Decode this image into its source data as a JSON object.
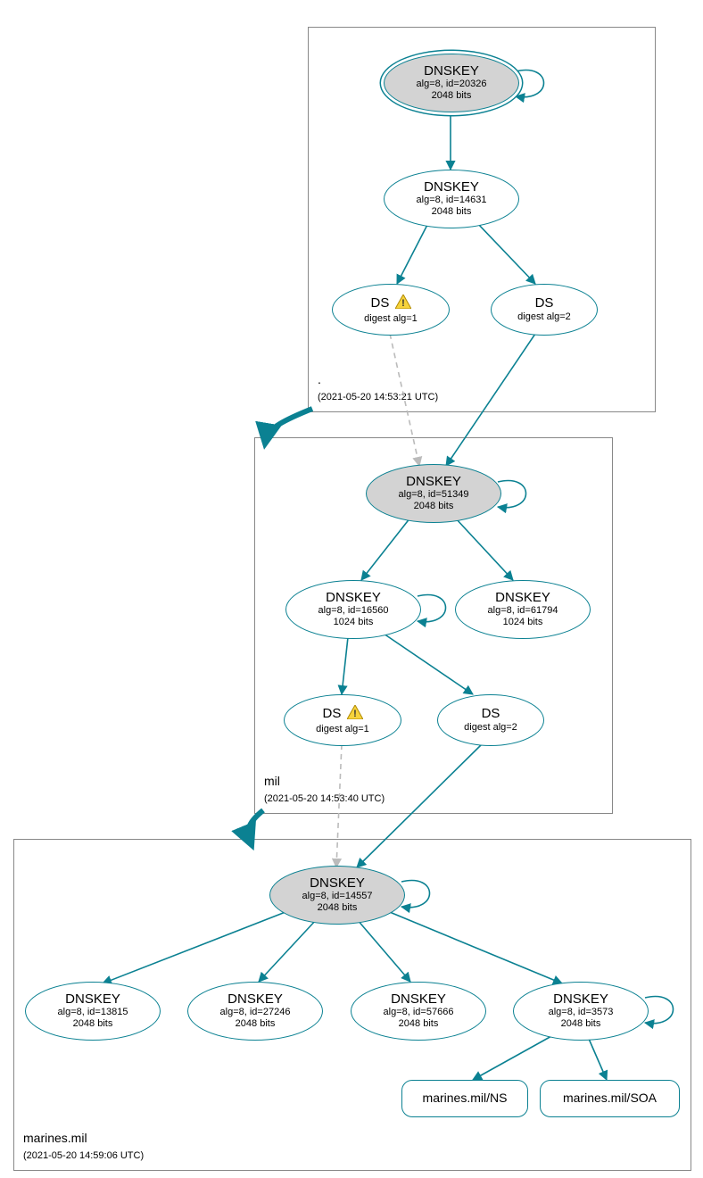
{
  "zones": {
    "root": {
      "name": ".",
      "timestamp": "(2021-05-20 14:53:21 UTC)"
    },
    "mil": {
      "name": "mil",
      "timestamp": "(2021-05-20 14:53:40 UTC)"
    },
    "marines": {
      "name": "marines.mil",
      "timestamp": "(2021-05-20 14:59:06 UTC)"
    }
  },
  "nodes": {
    "root_ksk": {
      "title": "DNSKEY",
      "line2": "alg=8, id=20326",
      "line3": "2048 bits"
    },
    "root_zsk": {
      "title": "DNSKEY",
      "line2": "alg=8, id=14631",
      "line3": "2048 bits"
    },
    "root_ds1": {
      "title": "DS",
      "line2": "digest alg=1"
    },
    "root_ds2": {
      "title": "DS",
      "line2": "digest alg=2"
    },
    "mil_ksk": {
      "title": "DNSKEY",
      "line2": "alg=8, id=51349",
      "line3": "2048 bits"
    },
    "mil_zsk1": {
      "title": "DNSKEY",
      "line2": "alg=8, id=16560",
      "line3": "1024 bits"
    },
    "mil_zsk2": {
      "title": "DNSKEY",
      "line2": "alg=8, id=61794",
      "line3": "1024 bits"
    },
    "mil_ds1": {
      "title": "DS",
      "line2": "digest alg=1"
    },
    "mil_ds2": {
      "title": "DS",
      "line2": "digest alg=2"
    },
    "mar_ksk": {
      "title": "DNSKEY",
      "line2": "alg=8, id=14557",
      "line3": "2048 bits"
    },
    "mar_k1": {
      "title": "DNSKEY",
      "line2": "alg=8, id=13815",
      "line3": "2048 bits"
    },
    "mar_k2": {
      "title": "DNSKEY",
      "line2": "alg=8, id=27246",
      "line3": "2048 bits"
    },
    "mar_k3": {
      "title": "DNSKEY",
      "line2": "alg=8, id=57666",
      "line3": "2048 bits"
    },
    "mar_k4": {
      "title": "DNSKEY",
      "line2": "alg=8, id=3573",
      "line3": "2048 bits"
    },
    "mar_ns": {
      "title": "marines.mil/NS"
    },
    "mar_soa": {
      "title": "marines.mil/SOA"
    }
  },
  "chart_data": {
    "type": "diagram",
    "description": "DNSSEC authentication chain / DNSViz-style graph for marines.mil",
    "zones": [
      {
        "name": ".",
        "timestamp": "2021-05-20 14:53:21 UTC"
      },
      {
        "name": "mil",
        "timestamp": "2021-05-20 14:53:40 UTC"
      },
      {
        "name": "marines.mil",
        "timestamp": "2021-05-20 14:59:06 UTC"
      }
    ],
    "nodes": [
      {
        "id": "root_ksk",
        "zone": ".",
        "type": "DNSKEY",
        "alg": 8,
        "key_id": 20326,
        "bits": 2048,
        "ksk": true,
        "trust_anchor": true
      },
      {
        "id": "root_zsk",
        "zone": ".",
        "type": "DNSKEY",
        "alg": 8,
        "key_id": 14631,
        "bits": 2048
      },
      {
        "id": "root_ds1",
        "zone": ".",
        "type": "DS",
        "digest_alg": 1,
        "warning": true
      },
      {
        "id": "root_ds2",
        "zone": ".",
        "type": "DS",
        "digest_alg": 2
      },
      {
        "id": "mil_ksk",
        "zone": "mil",
        "type": "DNSKEY",
        "alg": 8,
        "key_id": 51349,
        "bits": 2048,
        "ksk": true
      },
      {
        "id": "mil_zsk1",
        "zone": "mil",
        "type": "DNSKEY",
        "alg": 8,
        "key_id": 16560,
        "bits": 1024
      },
      {
        "id": "mil_zsk2",
        "zone": "mil",
        "type": "DNSKEY",
        "alg": 8,
        "key_id": 61794,
        "bits": 1024
      },
      {
        "id": "mil_ds1",
        "zone": "mil",
        "type": "DS",
        "digest_alg": 1,
        "warning": true
      },
      {
        "id": "mil_ds2",
        "zone": "mil",
        "type": "DS",
        "digest_alg": 2
      },
      {
        "id": "mar_ksk",
        "zone": "marines.mil",
        "type": "DNSKEY",
        "alg": 8,
        "key_id": 14557,
        "bits": 2048,
        "ksk": true
      },
      {
        "id": "mar_k1",
        "zone": "marines.mil",
        "type": "DNSKEY",
        "alg": 8,
        "key_id": 13815,
        "bits": 2048
      },
      {
        "id": "mar_k2",
        "zone": "marines.mil",
        "type": "DNSKEY",
        "alg": 8,
        "key_id": 27246,
        "bits": 2048
      },
      {
        "id": "mar_k3",
        "zone": "marines.mil",
        "type": "DNSKEY",
        "alg": 8,
        "key_id": 57666,
        "bits": 2048
      },
      {
        "id": "mar_k4",
        "zone": "marines.mil",
        "type": "DNSKEY",
        "alg": 8,
        "key_id": 3573,
        "bits": 2048
      },
      {
        "id": "mar_ns",
        "zone": "marines.mil",
        "type": "RRset",
        "name": "marines.mil/NS"
      },
      {
        "id": "mar_soa",
        "zone": "marines.mil",
        "type": "RRset",
        "name": "marines.mil/SOA"
      }
    ],
    "edges": [
      {
        "from": "root_ksk",
        "to": "root_ksk",
        "style": "self"
      },
      {
        "from": "root_ksk",
        "to": "root_zsk",
        "style": "solid"
      },
      {
        "from": "root_zsk",
        "to": "root_ds1",
        "style": "solid"
      },
      {
        "from": "root_zsk",
        "to": "root_ds2",
        "style": "solid"
      },
      {
        "from": "root_ds1",
        "to": "mil_ksk",
        "style": "dashed-gray"
      },
      {
        "from": "root_ds2",
        "to": "mil_ksk",
        "style": "solid"
      },
      {
        "from": "mil_ksk",
        "to": "mil_ksk",
        "style": "self"
      },
      {
        "from": "mil_ksk",
        "to": "mil_zsk1",
        "style": "solid"
      },
      {
        "from": "mil_ksk",
        "to": "mil_zsk2",
        "style": "solid"
      },
      {
        "from": "mil_zsk1",
        "to": "mil_zsk1",
        "style": "self"
      },
      {
        "from": "mil_zsk1",
        "to": "mil_ds1",
        "style": "solid"
      },
      {
        "from": "mil_zsk1",
        "to": "mil_ds2",
        "style": "solid"
      },
      {
        "from": "mil_ds1",
        "to": "mar_ksk",
        "style": "dashed-gray"
      },
      {
        "from": "mil_ds2",
        "to": "mar_ksk",
        "style": "solid"
      },
      {
        "from": "mar_ksk",
        "to": "mar_ksk",
        "style": "self"
      },
      {
        "from": "mar_ksk",
        "to": "mar_k1",
        "style": "solid"
      },
      {
        "from": "mar_ksk",
        "to": "mar_k2",
        "style": "solid"
      },
      {
        "from": "mar_ksk",
        "to": "mar_k3",
        "style": "solid"
      },
      {
        "from": "mar_ksk",
        "to": "mar_k4",
        "style": "solid"
      },
      {
        "from": "mar_k4",
        "to": "mar_k4",
        "style": "self"
      },
      {
        "from": "mar_k4",
        "to": "mar_ns",
        "style": "solid"
      },
      {
        "from": "mar_k4",
        "to": "mar_soa",
        "style": "solid"
      },
      {
        "from": "zone:.",
        "to": "zone:mil",
        "style": "zone-arrow"
      },
      {
        "from": "zone:mil",
        "to": "zone:marines.mil",
        "style": "zone-arrow"
      }
    ]
  }
}
